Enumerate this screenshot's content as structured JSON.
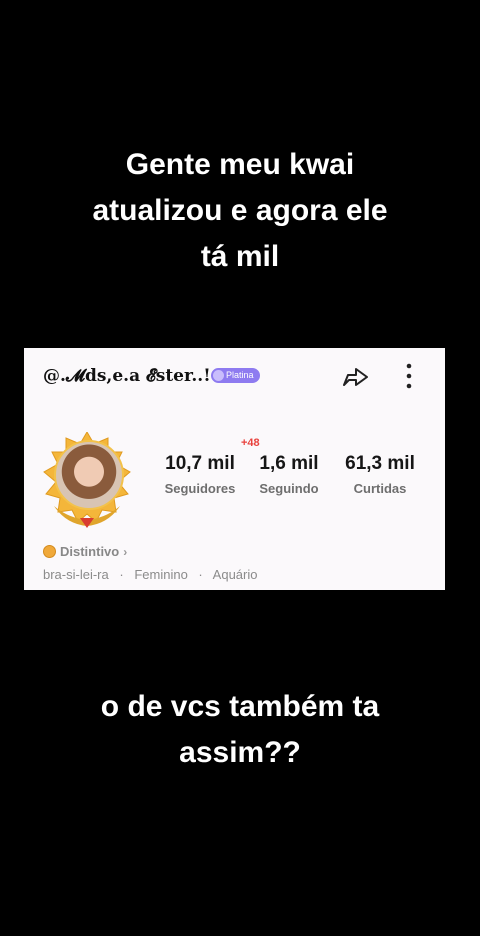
{
  "caption_top": {
    "line1": "Gente meu kwai",
    "line2": "atualizou e agora ele",
    "line3": "tá mil"
  },
  "caption_bottom": {
    "line1": "o de vcs também ta",
    "line2": "assim??"
  },
  "profile": {
    "username": "@.𝓜ds,e.a 𝓔ster..!",
    "badge_label": "Platina",
    "stats": {
      "followers": {
        "value": "10,7 mil",
        "label": "Seguidores"
      },
      "following": {
        "value": "1,6 mil",
        "label": "Seguindo",
        "delta": "+48"
      },
      "likes": {
        "value": "61,3 mil",
        "label": "Curtidas"
      }
    },
    "distintivo_label": "Distintivo",
    "info": {
      "nationality": "bra-si-lei-ra",
      "gender": "Feminino",
      "sign": "Aquário"
    }
  },
  "colors": {
    "badge": "#8e7bf0",
    "delta": "#e8423d",
    "frame_gold": "#f3c24a"
  },
  "icons": {
    "share": "share-arrow-icon",
    "more": "more-vertical-icon",
    "medal": "medal-icon"
  }
}
